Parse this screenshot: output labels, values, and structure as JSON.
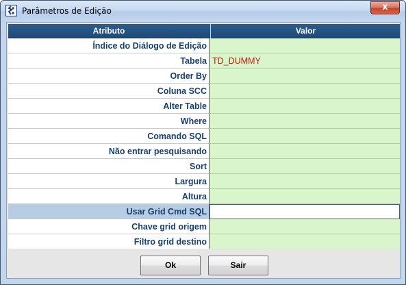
{
  "window": {
    "title": "Parâmetros de Edição",
    "close_label": "x"
  },
  "grid": {
    "columns": [
      "Atributo",
      "Valor"
    ],
    "rows": [
      {
        "attribute": "Índice do Diálogo de Edição",
        "value": ""
      },
      {
        "attribute": "Tabela",
        "value": "TD_DUMMY"
      },
      {
        "attribute": "Order By",
        "value": ""
      },
      {
        "attribute": "Coluna SCC",
        "value": ""
      },
      {
        "attribute": "Alter Table",
        "value": ""
      },
      {
        "attribute": "Where",
        "value": ""
      },
      {
        "attribute": "Comando SQL",
        "value": ""
      },
      {
        "attribute": "Não entrar pesquisando",
        "value": ""
      },
      {
        "attribute": "Sort",
        "value": ""
      },
      {
        "attribute": "Largura",
        "value": ""
      },
      {
        "attribute": "Altura",
        "value": ""
      },
      {
        "attribute": "Usar Grid Cmd SQL",
        "value": "",
        "selected": true
      },
      {
        "attribute": "Chave grid origem",
        "value": ""
      },
      {
        "attribute": "Filtro grid destino",
        "value": ""
      }
    ]
  },
  "buttons": {
    "ok_label": "Ok",
    "exit_label": "Sair"
  },
  "colors": {
    "header_bg": "#1d4b7a",
    "value_cell_bg": "#d9f5cc",
    "attribute_text": "#1a3f6b",
    "value_text": "#b32410",
    "selected_row_bg": "#b7cde3"
  },
  "icons": {
    "app_icon": "app-logo-icon",
    "close_icon": "close-icon"
  }
}
